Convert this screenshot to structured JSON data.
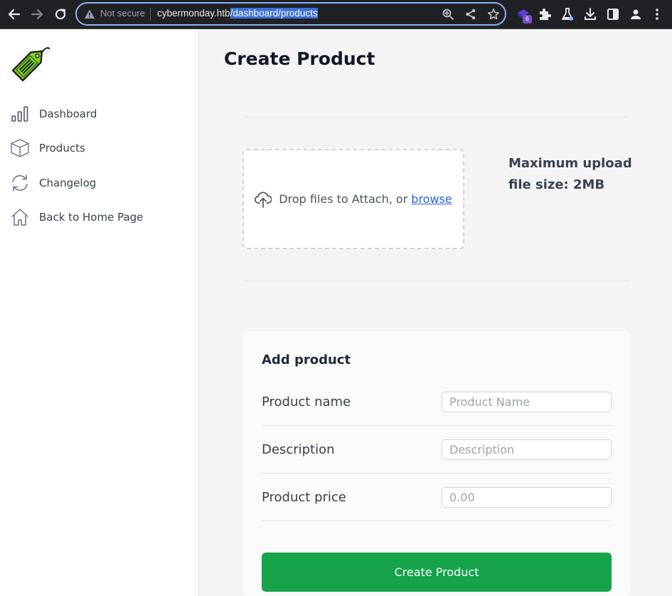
{
  "browser": {
    "security_label": "Not secure",
    "url_host": "cybermonday.htb",
    "url_path": "/dashboard/products",
    "extension_badge": "6"
  },
  "sidebar": {
    "logo_alt": "CYBER MONDAY",
    "items": [
      {
        "label": "Dashboard",
        "icon": "bar-chart-icon"
      },
      {
        "label": "Products",
        "icon": "box-icon"
      },
      {
        "label": "Changelog",
        "icon": "refresh-icon"
      },
      {
        "label": "Back to Home Page",
        "icon": "home-icon"
      }
    ]
  },
  "main": {
    "title": "Create Product",
    "upload": {
      "drop_text": "Drop files to Attach, or",
      "browse_label": "browse",
      "max_size": "Maximum upload file size: 2MB"
    },
    "form": {
      "title": "Add product",
      "fields": [
        {
          "label": "Product name",
          "placeholder": "Product Name"
        },
        {
          "label": "Description",
          "placeholder": "Description"
        },
        {
          "label": "Product price",
          "placeholder": "0.00"
        }
      ],
      "submit_label": "Create Product"
    }
  },
  "colors": {
    "accent": "#16a34a",
    "link": "#2563eb",
    "logo_green": "#7ed321"
  }
}
